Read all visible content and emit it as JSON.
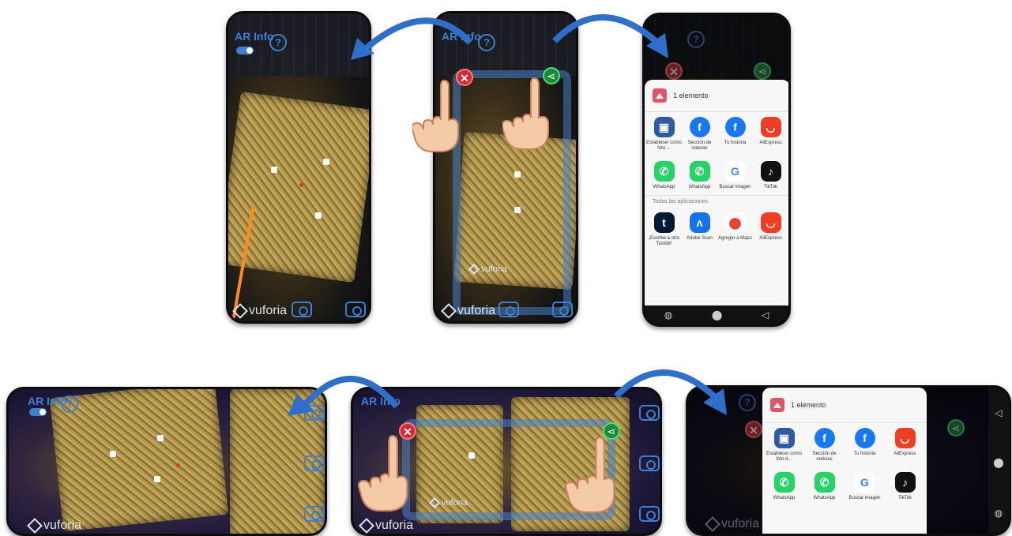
{
  "overlay": {
    "ar_info": "AR Info",
    "help": "?",
    "vuforia": "vuforia",
    "close_symbol": "✕",
    "share_symbol": "⋖"
  },
  "share_sheet": {
    "title": "1 elemento",
    "section_all_apps": "Todas las aplicaciones",
    "apps_row1": [
      "Establecer como foto ...",
      "Sección de noticias",
      "Tu historia",
      "AliExpress"
    ],
    "apps_row2": [
      "WhatsApp",
      "WhatsApp",
      "Buscar imagen",
      "TikTok"
    ],
    "apps_row3": [
      "¡Escribe a otro Tumblr!",
      "Adobe Scan",
      "Agregar a Maps",
      "AliExpress"
    ],
    "apps_landscape_row1": [
      "Establecer como foto d...",
      "Sección de noticias",
      "Tu historia",
      "AliExpress"
    ],
    "apps_landscape_row2": [
      "WhatsApp",
      "WhatsApp",
      "Buscar imagen",
      "TikTok"
    ]
  },
  "icons": {
    "establecer": "contact-photo-icon",
    "facebook": "facebook-icon",
    "aliexpress": "aliexpress-icon",
    "whatsapp": "whatsapp-icon",
    "google": "google-icon",
    "tiktok": "tiktok-icon",
    "tumblr": "tumblr-icon",
    "adobe": "adobe-scan-icon",
    "maps": "maps-icon"
  },
  "colors": {
    "accent_blue": "#3d7fd0",
    "close_red": "#d42a36",
    "share_green": "#1c8c3a",
    "arrow_blue": "#2f6fc9"
  }
}
